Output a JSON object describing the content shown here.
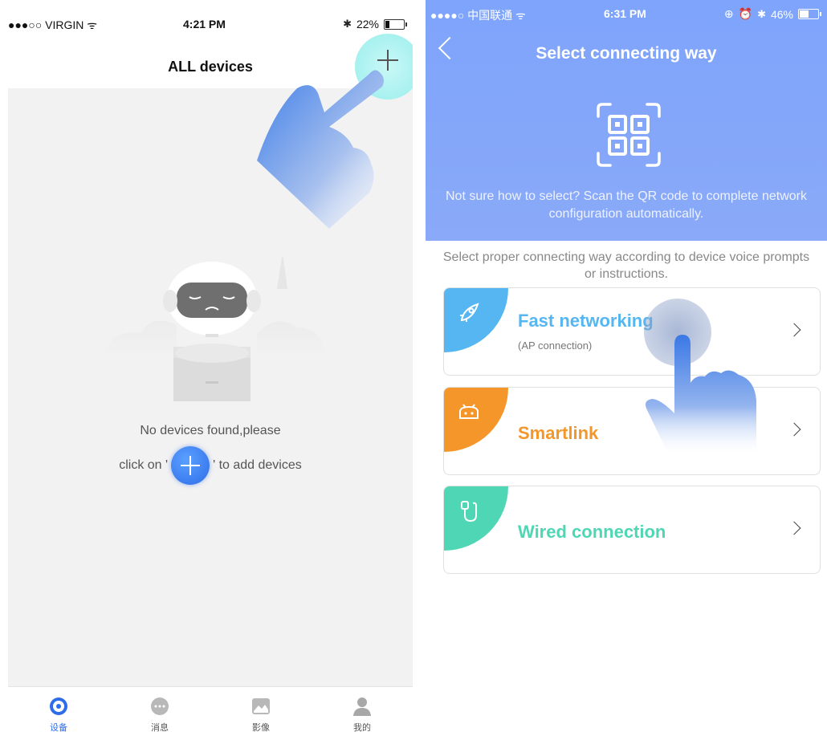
{
  "left_screen": {
    "status_bar": {
      "carrier": "●●●○○ VIRGIN ᯤ",
      "time": "4:21 PM",
      "battery": "22%",
      "battery_level": 0.22
    },
    "title": "ALL devices",
    "empty_state": {
      "line1": "No devices found,please",
      "line2_before": "click on '",
      "line2_after": "' to add devices"
    },
    "tabs": [
      {
        "label": "设备",
        "icon": "device-icon",
        "active": true
      },
      {
        "label": "消息",
        "icon": "message-icon",
        "active": false
      },
      {
        "label": "影像",
        "icon": "image-icon",
        "active": false
      },
      {
        "label": "我的",
        "icon": "profile-icon",
        "active": false
      }
    ]
  },
  "right_screen": {
    "status_bar": {
      "carrier": "●●●●○ 中国联通 ᯤ",
      "time": "6:31 PM",
      "battery": "46%",
      "battery_level": 0.46
    },
    "title": "Select connecting way",
    "header_hint": "Not sure how to select? Scan the QR code to complete network configuration automatically.",
    "select_hint": "Select proper connecting way according to device voice prompts or instructions.",
    "options": [
      {
        "name": "Fast networking",
        "sub": "(AP connection)",
        "icon": "rocket-icon",
        "color": "#55b6f2"
      },
      {
        "name": "Smartlink",
        "sub": "",
        "icon": "android-icon",
        "color": "#f4962a"
      },
      {
        "name": "Wired connection",
        "sub": "",
        "icon": "cable-plug-icon",
        "color": "#4fd6b4"
      }
    ]
  },
  "colors": {
    "header_blue": "#7ea4fb",
    "accent_blue": "#2f6de8",
    "add_highlight": "#a7f1ef"
  }
}
